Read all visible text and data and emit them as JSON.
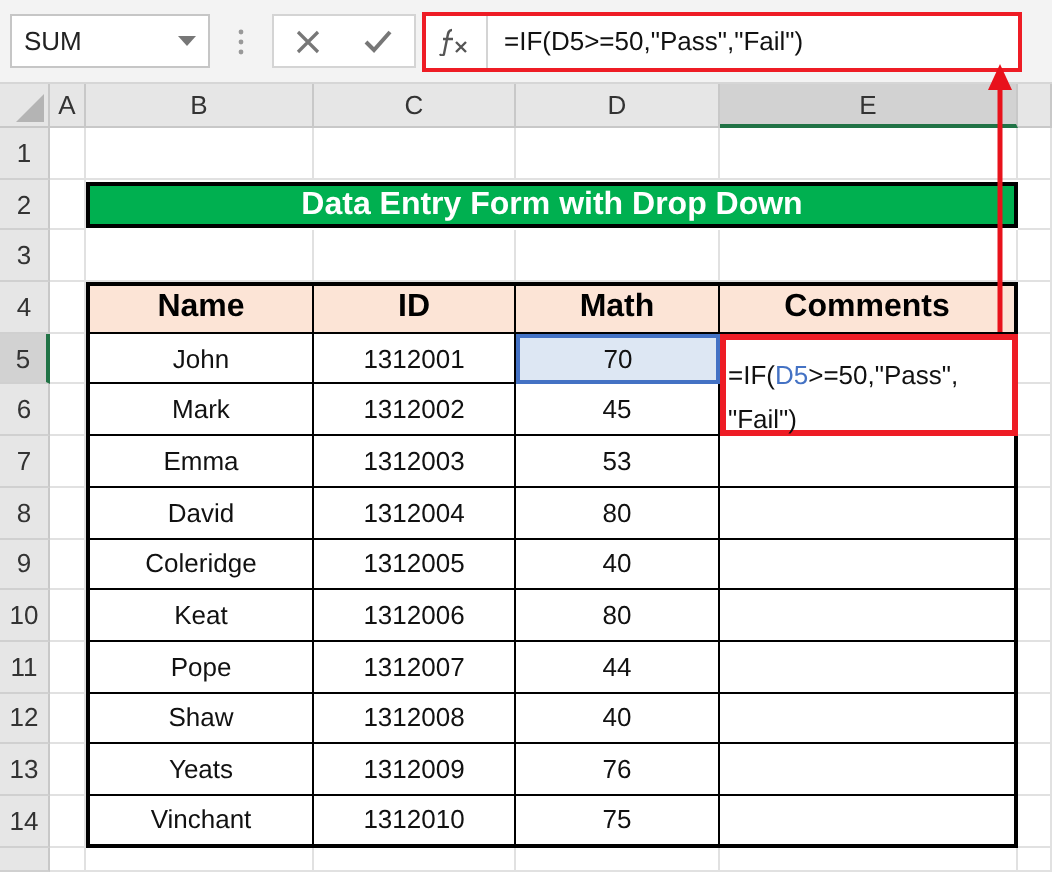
{
  "name_box": {
    "value": "SUM"
  },
  "formula_bar": {
    "formula": "=IF(D5>=50,\"Pass\",\"Fail\")"
  },
  "columns": [
    {
      "label": "A",
      "selected": false
    },
    {
      "label": "B",
      "selected": false
    },
    {
      "label": "C",
      "selected": false
    },
    {
      "label": "D",
      "selected": false
    },
    {
      "label": "E",
      "selected": true
    }
  ],
  "row_headers": [
    {
      "label": "1",
      "selected": false
    },
    {
      "label": "2",
      "selected": false
    },
    {
      "label": "3",
      "selected": false
    },
    {
      "label": "4",
      "selected": false
    },
    {
      "label": "5",
      "selected": true
    },
    {
      "label": "6",
      "selected": false
    },
    {
      "label": "7",
      "selected": false
    },
    {
      "label": "8",
      "selected": false
    },
    {
      "label": "9",
      "selected": false
    },
    {
      "label": "10",
      "selected": false
    },
    {
      "label": "11",
      "selected": false
    },
    {
      "label": "12",
      "selected": false
    },
    {
      "label": "13",
      "selected": false
    },
    {
      "label": "14",
      "selected": false
    }
  ],
  "title": "Data Entry Form with Drop Down",
  "table": {
    "columns": [
      "Name",
      "ID",
      "Math",
      "Comments"
    ],
    "rows": [
      {
        "name": "John",
        "id": "1312001",
        "math": "70",
        "selected": true
      },
      {
        "name": "Mark",
        "id": "1312002",
        "math": "45",
        "selected": false
      },
      {
        "name": "Emma",
        "id": "1312003",
        "math": "53",
        "selected": false
      },
      {
        "name": "David",
        "id": "1312004",
        "math": "80",
        "selected": false
      },
      {
        "name": "Coleridge",
        "id": "1312005",
        "math": "40",
        "selected": false
      },
      {
        "name": "Keat",
        "id": "1312006",
        "math": "80",
        "selected": false
      },
      {
        "name": "Pope",
        "id": "1312007",
        "math": "44",
        "selected": false
      },
      {
        "name": "Shaw",
        "id": "1312008",
        "math": "40",
        "selected": false
      },
      {
        "name": "Yeats",
        "id": "1312009",
        "math": "76",
        "selected": false
      },
      {
        "name": "Vinchant",
        "id": "1312010",
        "math": "75",
        "selected": false
      }
    ]
  },
  "editing_cell": {
    "parts": [
      {
        "text": "=IF(",
        "kind": "plain"
      },
      {
        "text": "D5",
        "kind": "reference"
      },
      {
        "text": ">=50,\"Pass\",",
        "kind": "plain"
      },
      {
        "text": "\"Fail\")",
        "kind": "plain"
      }
    ]
  }
}
